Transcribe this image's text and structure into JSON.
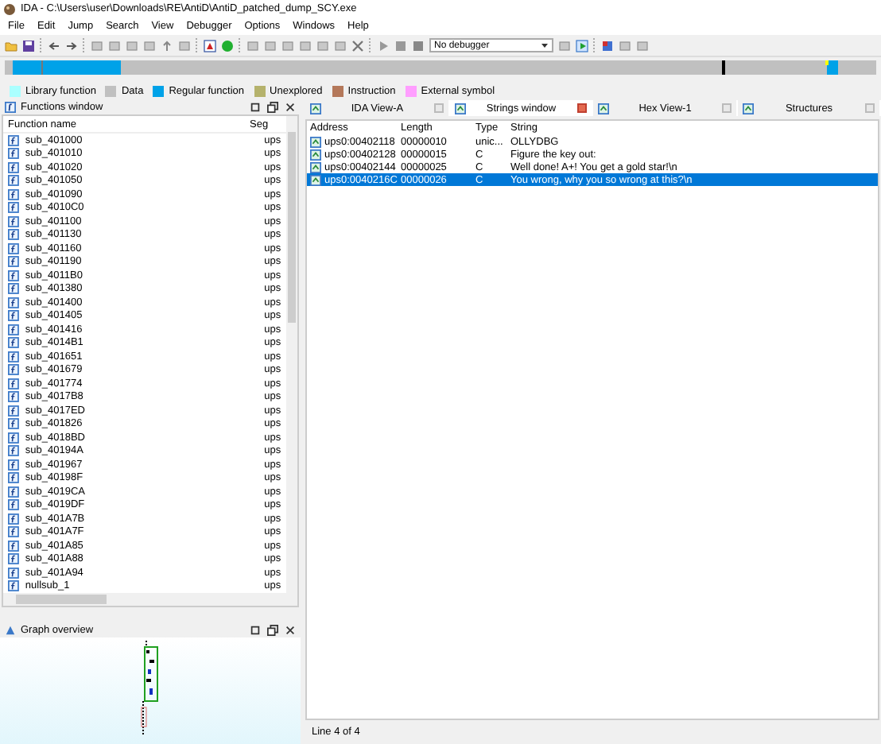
{
  "window": {
    "title": "IDA - C:\\Users\\user\\Downloads\\RE\\AntiD\\AntiD_patched_dump_SCY.exe"
  },
  "menu": [
    "File",
    "Edit",
    "Jump",
    "Search",
    "View",
    "Debugger",
    "Options",
    "Windows",
    "Help"
  ],
  "toolbar": {
    "debugger_select": "No debugger"
  },
  "legend": [
    {
      "label": "Library function",
      "color": "#aaffff"
    },
    {
      "label": "Data",
      "color": "#c0c0c0"
    },
    {
      "label": "Regular function",
      "color": "#00a2e8"
    },
    {
      "label": "Unexplored",
      "color": "#b5b26c"
    },
    {
      "label": "Instruction",
      "color": "#b4785a"
    },
    {
      "label": "External symbol",
      "color": "#ff9eff"
    }
  ],
  "functions_window": {
    "title": "Functions window",
    "columns": [
      "Function name",
      "Seg"
    ],
    "rows": [
      {
        "name": "sub_401000",
        "segment": "ups"
      },
      {
        "name": "sub_401010",
        "segment": "ups"
      },
      {
        "name": "sub_401020",
        "segment": "ups"
      },
      {
        "name": "sub_401050",
        "segment": "ups"
      },
      {
        "name": "sub_401090",
        "segment": "ups"
      },
      {
        "name": "sub_4010C0",
        "segment": "ups"
      },
      {
        "name": "sub_401100",
        "segment": "ups"
      },
      {
        "name": "sub_401130",
        "segment": "ups"
      },
      {
        "name": "sub_401160",
        "segment": "ups"
      },
      {
        "name": "sub_401190",
        "segment": "ups"
      },
      {
        "name": "sub_4011B0",
        "segment": "ups"
      },
      {
        "name": "sub_401380",
        "segment": "ups"
      },
      {
        "name": "sub_401400",
        "segment": "ups"
      },
      {
        "name": "sub_401405",
        "segment": "ups"
      },
      {
        "name": "sub_401416",
        "segment": "ups"
      },
      {
        "name": "sub_4014B1",
        "segment": "ups"
      },
      {
        "name": "sub_401651",
        "segment": "ups"
      },
      {
        "name": "sub_401679",
        "segment": "ups"
      },
      {
        "name": "sub_401774",
        "segment": "ups"
      },
      {
        "name": "sub_4017B8",
        "segment": "ups"
      },
      {
        "name": "sub_4017ED",
        "segment": "ups"
      },
      {
        "name": "sub_401826",
        "segment": "ups"
      },
      {
        "name": "sub_4018BD",
        "segment": "ups"
      },
      {
        "name": "sub_40194A",
        "segment": "ups"
      },
      {
        "name": "sub_401967",
        "segment": "ups"
      },
      {
        "name": "sub_40198F",
        "segment": "ups"
      },
      {
        "name": "sub_4019CA",
        "segment": "ups"
      },
      {
        "name": "sub_4019DF",
        "segment": "ups"
      },
      {
        "name": "sub_401A7B",
        "segment": "ups"
      },
      {
        "name": "sub_401A7F",
        "segment": "ups"
      },
      {
        "name": "sub_401A85",
        "segment": "ups"
      },
      {
        "name": "sub_401A88",
        "segment": "ups"
      },
      {
        "name": "sub_401A94",
        "segment": "ups"
      },
      {
        "name": "nullsub_1",
        "segment": "ups"
      }
    ]
  },
  "graph_overview": {
    "title": "Graph overview"
  },
  "tabs": [
    {
      "label": "IDA View-A",
      "selected": false
    },
    {
      "label": "Strings window",
      "selected": true
    },
    {
      "label": "Hex View-1",
      "selected": false
    },
    {
      "label": "Structures",
      "selected": false
    }
  ],
  "strings_window": {
    "columns": [
      "Address",
      "Length",
      "Type",
      "String"
    ],
    "rows": [
      {
        "address": "ups0:00402118",
        "length": "00000010",
        "type": "unic...",
        "string": "OLLYDBG",
        "selected": false
      },
      {
        "address": "ups0:00402128",
        "length": "00000015",
        "type": "C",
        "string": "Figure the key out:",
        "selected": false
      },
      {
        "address": "ups0:00402144",
        "length": "00000025",
        "type": "C",
        "string": "Well done! A+! You get a gold star!\\n",
        "selected": false
      },
      {
        "address": "ups0:0040216C",
        "length": "00000026",
        "type": "C",
        "string": "You wrong, why you so wrong at this?\\n",
        "selected": true
      }
    ]
  },
  "status_bar": "Line 4 of 4"
}
